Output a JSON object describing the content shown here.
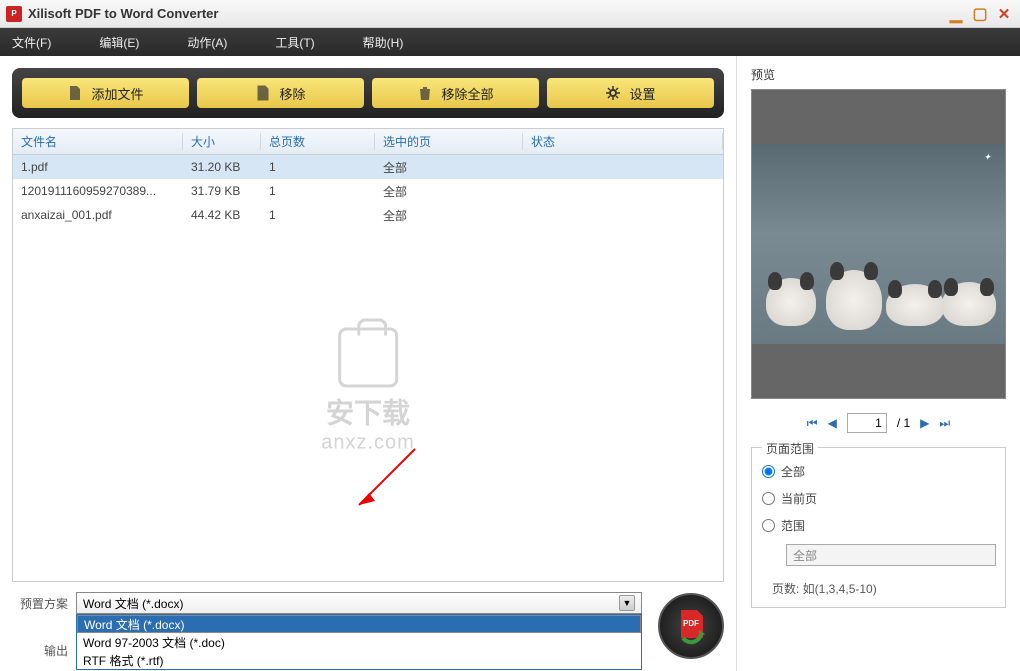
{
  "title": "Xilisoft PDF to Word Converter",
  "menu": [
    "文件(F)",
    "编辑(E)",
    "动作(A)",
    "工具(T)",
    "帮助(H)"
  ],
  "toolbar": {
    "add": "添加文件",
    "remove": "移除",
    "remove_all": "移除全部",
    "settings": "设置"
  },
  "table": {
    "headers": [
      "文件名",
      "大小",
      "总页数",
      "选中的页",
      "状态"
    ],
    "rows": [
      {
        "name": "1.pdf",
        "size": "31.20 KB",
        "pages": "1",
        "selected": "全部",
        "status": "",
        "sel": true
      },
      {
        "name": "1201911160959270389...",
        "size": "31.79 KB",
        "pages": "1",
        "selected": "全部",
        "status": "",
        "sel": false
      },
      {
        "name": "anxaizai_001.pdf",
        "size": "44.42 KB",
        "pages": "1",
        "selected": "全部",
        "status": "",
        "sel": false
      }
    ]
  },
  "watermark": {
    "cn": "安下载",
    "en": "anxz.com"
  },
  "preset": {
    "label": "预置方案",
    "value": "Word 文档 (*.docx)",
    "options": [
      {
        "text": "Word 文档 (*.docx)",
        "sel": true
      },
      {
        "text": "Word 97-2003 文档 (*.doc)",
        "sel": false
      },
      {
        "text": "RTF 格式 (*.rtf)",
        "sel": false
      }
    ]
  },
  "output_label": "输出",
  "preview": {
    "title": "预览"
  },
  "pager": {
    "page": "1",
    "total": "/ 1"
  },
  "range": {
    "legend": "页面范围",
    "all": "全部",
    "current": "当前页",
    "range": "范围",
    "range_value": "全部",
    "hint": "页数: 如(1,3,4,5-10)"
  }
}
